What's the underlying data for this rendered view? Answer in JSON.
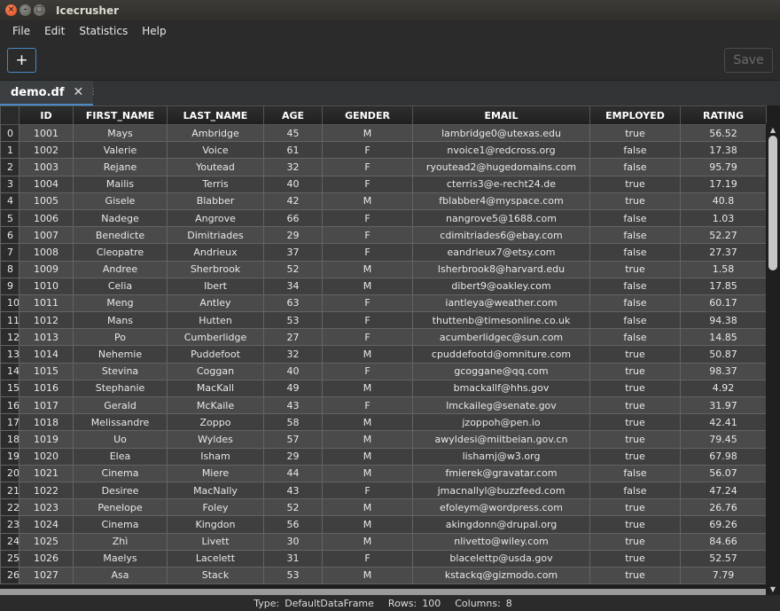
{
  "window": {
    "title": "Icecrusher"
  },
  "menubar": {
    "items": [
      "File",
      "Edit",
      "Statistics",
      "Help"
    ]
  },
  "toolbar": {
    "add_label": "+",
    "save_label": "Save"
  },
  "tabs": [
    {
      "label": "demo.df"
    }
  ],
  "table": {
    "columns": [
      "ID",
      "FIRST_NAME",
      "LAST_NAME",
      "AGE",
      "GENDER",
      "EMAIL",
      "EMPLOYED",
      "RATING"
    ],
    "rows": [
      [
        "0",
        "1001",
        "Mays",
        "Ambridge",
        "45",
        "M",
        "lambridge0@utexas.edu",
        "true",
        "56.52"
      ],
      [
        "1",
        "1002",
        "Valerie",
        "Voice",
        "61",
        "F",
        "nvoice1@redcross.org",
        "false",
        "17.38"
      ],
      [
        "2",
        "1003",
        "Rejane",
        "Youtead",
        "32",
        "F",
        "ryoutead2@hugedomains.com",
        "false",
        "95.79"
      ],
      [
        "3",
        "1004",
        "Mailis",
        "Terris",
        "40",
        "F",
        "cterris3@e-recht24.de",
        "true",
        "17.19"
      ],
      [
        "4",
        "1005",
        "Gisele",
        "Blabber",
        "42",
        "M",
        "fblabber4@myspace.com",
        "true",
        "40.8"
      ],
      [
        "5",
        "1006",
        "Nadege",
        "Angrove",
        "66",
        "F",
        "nangrove5@1688.com",
        "false",
        "1.03"
      ],
      [
        "6",
        "1007",
        "Benedicte",
        "Dimitriades",
        "29",
        "F",
        "cdimitriades6@ebay.com",
        "false",
        "52.27"
      ],
      [
        "7",
        "1008",
        "Cleopatre",
        "Andrieux",
        "37",
        "F",
        "eandrieux7@etsy.com",
        "false",
        "27.37"
      ],
      [
        "8",
        "1009",
        "Andree",
        "Sherbrook",
        "52",
        "M",
        "lsherbrook8@harvard.edu",
        "true",
        "1.58"
      ],
      [
        "9",
        "1010",
        "Celia",
        "Ibert",
        "34",
        "M",
        "dibert9@oakley.com",
        "false",
        "17.85"
      ],
      [
        "10",
        "1011",
        "Meng",
        "Antley",
        "63",
        "F",
        "iantleya@weather.com",
        "false",
        "60.17"
      ],
      [
        "11",
        "1012",
        "Mans",
        "Hutten",
        "53",
        "F",
        "thuttenb@timesonline.co.uk",
        "false",
        "94.38"
      ],
      [
        "12",
        "1013",
        "Po",
        "Cumberlidge",
        "27",
        "F",
        "acumberlidgec@sun.com",
        "false",
        "14.85"
      ],
      [
        "13",
        "1014",
        "Nehemie",
        "Puddefoot",
        "32",
        "M",
        "cpuddefootd@omniture.com",
        "true",
        "50.87"
      ],
      [
        "14",
        "1015",
        "Stevina",
        "Coggan",
        "40",
        "F",
        "gcoggane@qq.com",
        "true",
        "98.37"
      ],
      [
        "15",
        "1016",
        "Stephanie",
        "MacKall",
        "49",
        "M",
        "bmackallf@hhs.gov",
        "true",
        "4.92"
      ],
      [
        "16",
        "1017",
        "Gerald",
        "McKaile",
        "43",
        "F",
        "lmckaileg@senate.gov",
        "true",
        "31.97"
      ],
      [
        "17",
        "1018",
        "Melissandre",
        "Zoppo",
        "58",
        "M",
        "jzoppoh@pen.io",
        "true",
        "42.41"
      ],
      [
        "18",
        "1019",
        "Uo",
        "Wyldes",
        "57",
        "M",
        "awyldesi@miitbeian.gov.cn",
        "true",
        "79.45"
      ],
      [
        "19",
        "1020",
        "Elea",
        "Isham",
        "29",
        "M",
        "lishamj@w3.org",
        "true",
        "67.98"
      ],
      [
        "20",
        "1021",
        "Cinema",
        "Miere",
        "44",
        "M",
        "fmierek@gravatar.com",
        "false",
        "56.07"
      ],
      [
        "21",
        "1022",
        "Desiree",
        "MacNally",
        "43",
        "F",
        "jmacnallyl@buzzfeed.com",
        "false",
        "47.24"
      ],
      [
        "22",
        "1023",
        "Penelope",
        "Foley",
        "52",
        "M",
        "efoleym@wordpress.com",
        "true",
        "26.76"
      ],
      [
        "23",
        "1024",
        "Cinema",
        "Kingdon",
        "56",
        "M",
        "akingdonn@drupal.org",
        "true",
        "69.26"
      ],
      [
        "24",
        "1025",
        "Zhì",
        "Livett",
        "30",
        "M",
        "nlivetto@wiley.com",
        "true",
        "84.66"
      ],
      [
        "25",
        "1026",
        "Maelys",
        "Lacelett",
        "31",
        "F",
        "blacelettp@usda.gov",
        "true",
        "52.57"
      ],
      [
        "26",
        "1027",
        "Asa",
        "Stack",
        "53",
        "M",
        "kstackq@gizmodo.com",
        "true",
        "7.79"
      ]
    ]
  },
  "status": {
    "type_label": "Type:",
    "type_value": "DefaultDataFrame",
    "rows_label": "Rows:",
    "rows_value": "100",
    "columns_label": "Columns:",
    "columns_value": "8"
  }
}
